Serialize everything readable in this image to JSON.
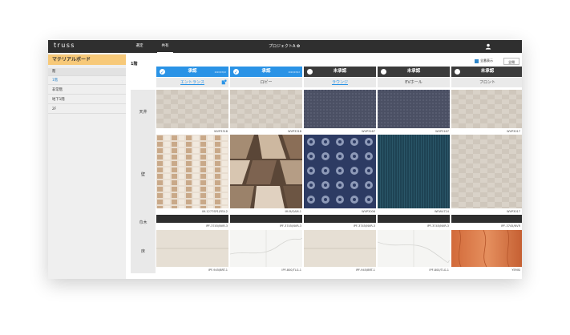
{
  "header": {
    "logo": "truss",
    "tabs": [
      {
        "label": "選定"
      },
      {
        "label": "共有"
      }
    ],
    "project": "プロジェクトA ✿"
  },
  "sidebar": {
    "title": "マテリアルボード",
    "items": [
      {
        "label": "階"
      },
      {
        "label": "1階"
      },
      {
        "label": "非常階"
      },
      {
        "label": "地下1階"
      },
      {
        "label": "2F"
      }
    ]
  },
  "main": {
    "floor_title": "1階",
    "show_all_label": "全番表示",
    "show_all_button": "全閉",
    "row_labels": {
      "ceiling": "天井",
      "wall": "壁",
      "baseboard": "巾木",
      "floor": "床"
    },
    "columns": [
      {
        "status": "承認",
        "status_sub": "2020/03/22",
        "room": "エントランス",
        "room_link": true,
        "ceiling_code": "WVP3318",
        "wall_code": "IM-1277SP1/FEX-2",
        "base_code": "IPF-3745/NVR-3",
        "floor_code": "IPF-945/BRT-1"
      },
      {
        "status": "承認",
        "status_sub": "2020/03/22",
        "room": "ロビー",
        "room_link": false,
        "ceiling_code": "WVP3318",
        "wall_code": "IM-R/GAM-1",
        "base_code": "IPF-3745/NVR-3",
        "floor_code": "IPF-800/TLG-1"
      },
      {
        "status": "未承認",
        "status_sub": "",
        "room": "ラウンジ",
        "room_link": true,
        "ceiling_code": "WVP3167",
        "wall_code": "WVP3006",
        "base_code": "IPF-3745/NVR-3",
        "floor_code": "IPF-945/BRT-1"
      },
      {
        "status": "未承認",
        "status_sub": "",
        "room": "EVホール",
        "room_link": false,
        "ceiling_code": "WVP3167",
        "wall_code": "WEW4724",
        "base_code": "IPF-3745/NVR-3",
        "floor_code": "IPF-800/TLG-1"
      },
      {
        "status": "未承認",
        "status_sub": "",
        "room": "フロント",
        "room_link": false,
        "ceiling_code": "WVP3017",
        "wall_code": "WVP3017",
        "base_code": "IPF-3745/NVR",
        "floor_code": "YEMSI"
      }
    ]
  },
  "colors": {
    "approved": "#2a93e6",
    "unapproved": "#3b3b3b",
    "accent": "#f7c979"
  }
}
